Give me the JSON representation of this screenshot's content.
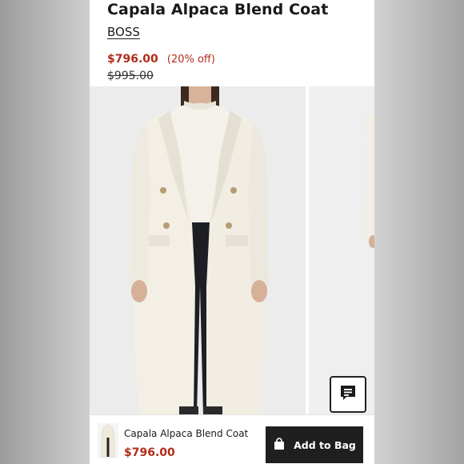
{
  "product": {
    "title": "Capala Alpaca Blend Coat",
    "brand": "BOSS",
    "sale_price": "$796.00",
    "discount": "(20% off)",
    "original_price": "$995.00"
  },
  "sticky_bar": {
    "title": "Capala Alpaca Blend Coat",
    "price": "$796.00",
    "add_to_bag_label": "Add to Bag"
  },
  "colors": {
    "sale_red": "#b22c1b",
    "button_dark": "#1f1f1f",
    "coat_cream": "#f2eee3"
  },
  "icons": [
    "chat-icon",
    "shopping-bag-icon"
  ]
}
